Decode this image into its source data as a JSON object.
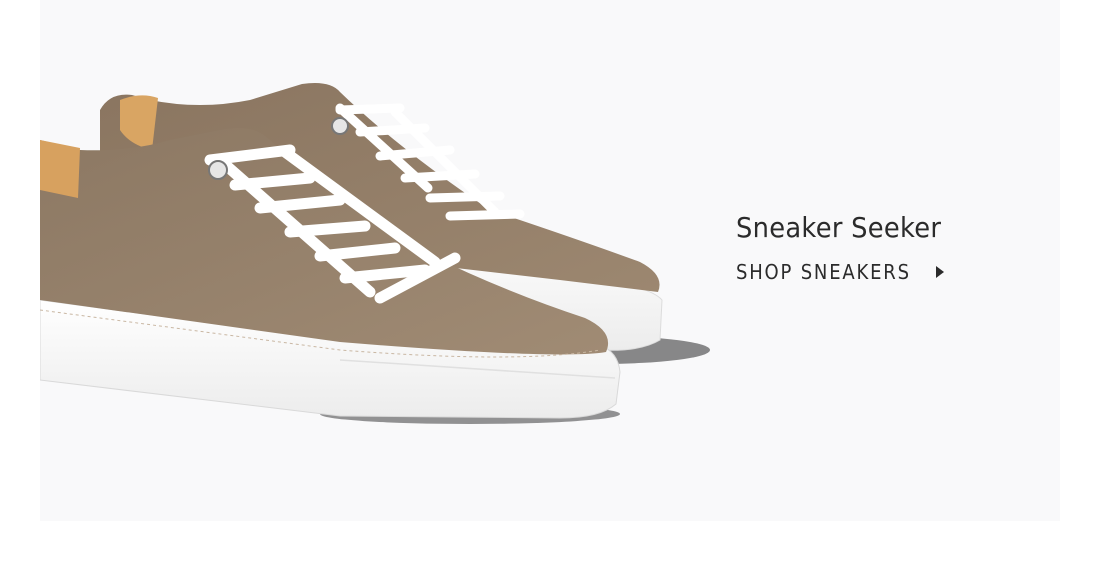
{
  "banner": {
    "background_color": "#f9f9fa",
    "image": {
      "icon": "sneaker-pair-image"
    },
    "title": "Sneaker Seeker",
    "cta": {
      "label": "SHOP SNEAKERS",
      "icon": "caret-right-icon"
    }
  }
}
